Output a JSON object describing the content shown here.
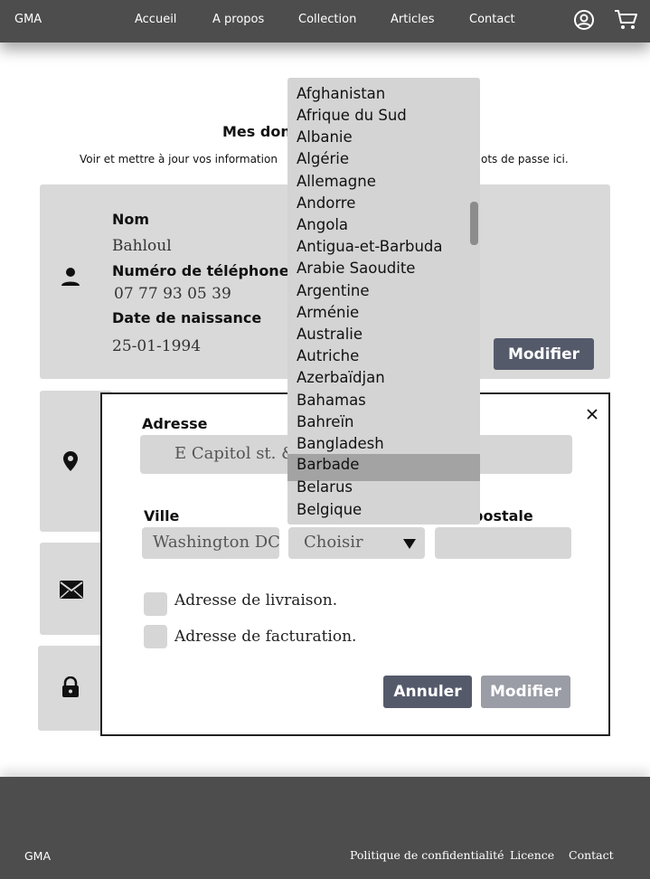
{
  "header": {
    "logo": "GMA",
    "nav": [
      "Accueil",
      "A propos",
      "Collection",
      "Articles",
      "Contact"
    ],
    "account_icon": "user-circle-icon",
    "cart_icon": "cart-icon"
  },
  "page": {
    "title": "Mes don",
    "subtitle_left": "Voir et mettre à jour vos information",
    "subtitle_right": "ots de passe ici."
  },
  "profile_card": {
    "icon": "person-icon",
    "name_label": "Nom",
    "name_value": "Bahloul",
    "phone_label": "Numéro de téléphone",
    "phone_value": "07 77 93 05 39",
    "birth_label": "Date de naissance",
    "birth_value": "25-01-1994",
    "edit_button": "Modifier"
  },
  "side_icons": [
    "location-pin-icon",
    "mail-icon",
    "lock-icon"
  ],
  "address_modal": {
    "address_label": "Adresse",
    "address_value": "E Capitol st. &",
    "city_label": "Ville",
    "city_value": "Washington DC",
    "country_select_value": "Choisir",
    "postal_label": "postale",
    "postal_value": "",
    "delivery_checkbox_label": "Adresse de livraison.",
    "billing_checkbox_label": "Adresse de facturation.",
    "cancel_button": "Annuler",
    "submit_button": "Modifier",
    "close_icon": "close-icon"
  },
  "country_dropdown": {
    "options": [
      "Afghanistan",
      "Afrique du Sud",
      "Albanie",
      "Algérie",
      "Allemagne",
      "Andorre",
      "Angola",
      "Antigua-et-Barbuda",
      "Arabie Saoudite",
      "Argentine",
      "Arménie",
      "Australie",
      "Autriche",
      "Azerbaïdjan",
      "Bahamas",
      "Bahreïn",
      "Bangladesh",
      "Barbade",
      "Belarus",
      "Belgique"
    ],
    "highlighted": "Barbade"
  },
  "footer": {
    "logo": "GMA",
    "links": [
      "Politique de confidentialité",
      "Licence",
      "Contact"
    ]
  },
  "colors": {
    "header_bg": "#4d4d4d",
    "card_bg": "#d9d9d9",
    "button_dark": "#555a6b",
    "button_light": "#9a9ca6",
    "dropdown_bg": "#d4d4d4",
    "dropdown_highlight": "#a3a3a3"
  }
}
